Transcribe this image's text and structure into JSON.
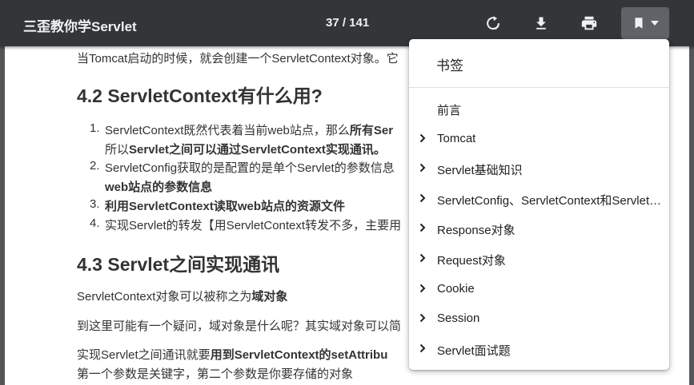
{
  "toolbar": {
    "title": "三歪教你学Servlet",
    "page_counter": "37 / 141",
    "icons": [
      "rotate-icon",
      "download-icon",
      "print-icon",
      "bookmark-icon",
      "caret-down-icon"
    ]
  },
  "content": {
    "line0": "当Tomcat启动的时候，就会创建一个ServletContext对象。它",
    "h42": "4.2 ServletContext有什么用?",
    "li1_a": "ServletContext既然代表着当前web站点，那么",
    "li1_b": "所有Ser",
    "li1_c": "所以",
    "li1_d": "Servlet之间可以通过ServletContext实现通讯。",
    "li2_a": "ServletConfig获取的是配置的是单个Servlet的参数信息",
    "li2_b": "web站点的参数信息",
    "li3": "利用ServletContext读取web站点的资源文件",
    "li4": "实现Servlet的转发【用ServletContext转发不多，主要用",
    "h43": "4.3 Servlet之间实现通讯",
    "p1_a": "ServletContext对象可以被称之为",
    "p1_b": "域对象",
    "p2": "到这里可能有一个疑问，域对象是什么呢？其实域对象可以简",
    "p3_a": "实现Servlet之间通讯就要",
    "p3_b": "用到ServletContext的setAttribu",
    "p4": "第一个参数是关键字，第二个参数是你要存储的对象",
    "num1": "1.",
    "num2": "2.",
    "num3": "3.",
    "num4": "4."
  },
  "bookmarks": {
    "header": "书签",
    "items": [
      {
        "label": "前言",
        "expandable": false
      },
      {
        "label": "Tomcat",
        "expandable": true
      },
      {
        "label": "Servlet基础知识",
        "expandable": true
      },
      {
        "label": "ServletConfig、ServletContext和Servlet…",
        "expandable": true
      },
      {
        "label": "Response对象",
        "expandable": true
      },
      {
        "label": "Request对象",
        "expandable": true
      },
      {
        "label": "Cookie",
        "expandable": true
      },
      {
        "label": "Session",
        "expandable": true
      },
      {
        "label": "Servlet面试题",
        "expandable": true
      }
    ]
  },
  "colors": {
    "toolbar_bg": "#323639",
    "viewer_bg": "#525659",
    "active_button_bg": "#5f6368",
    "text": "#333333"
  }
}
